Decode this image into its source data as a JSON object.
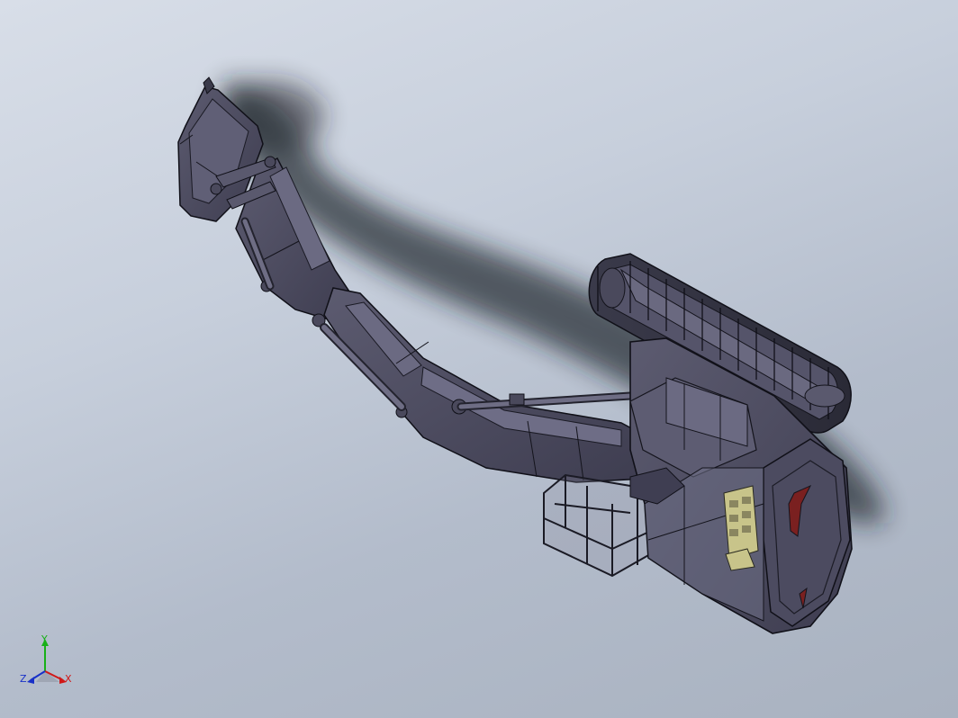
{
  "view": {
    "background_colors": [
      "#d8dee8",
      "#a9b2c0"
    ],
    "model_color": "#4b4a5e",
    "edge_color": "#14141c",
    "highlight_color": "#c8c48a"
  },
  "triad": {
    "x_label": "X",
    "y_label": "Y",
    "z_label": "Z",
    "x_color": "#d01818",
    "y_color": "#18b018",
    "z_color": "#1830c8"
  },
  "model": {
    "name_icon": "excavator-3d-model"
  }
}
